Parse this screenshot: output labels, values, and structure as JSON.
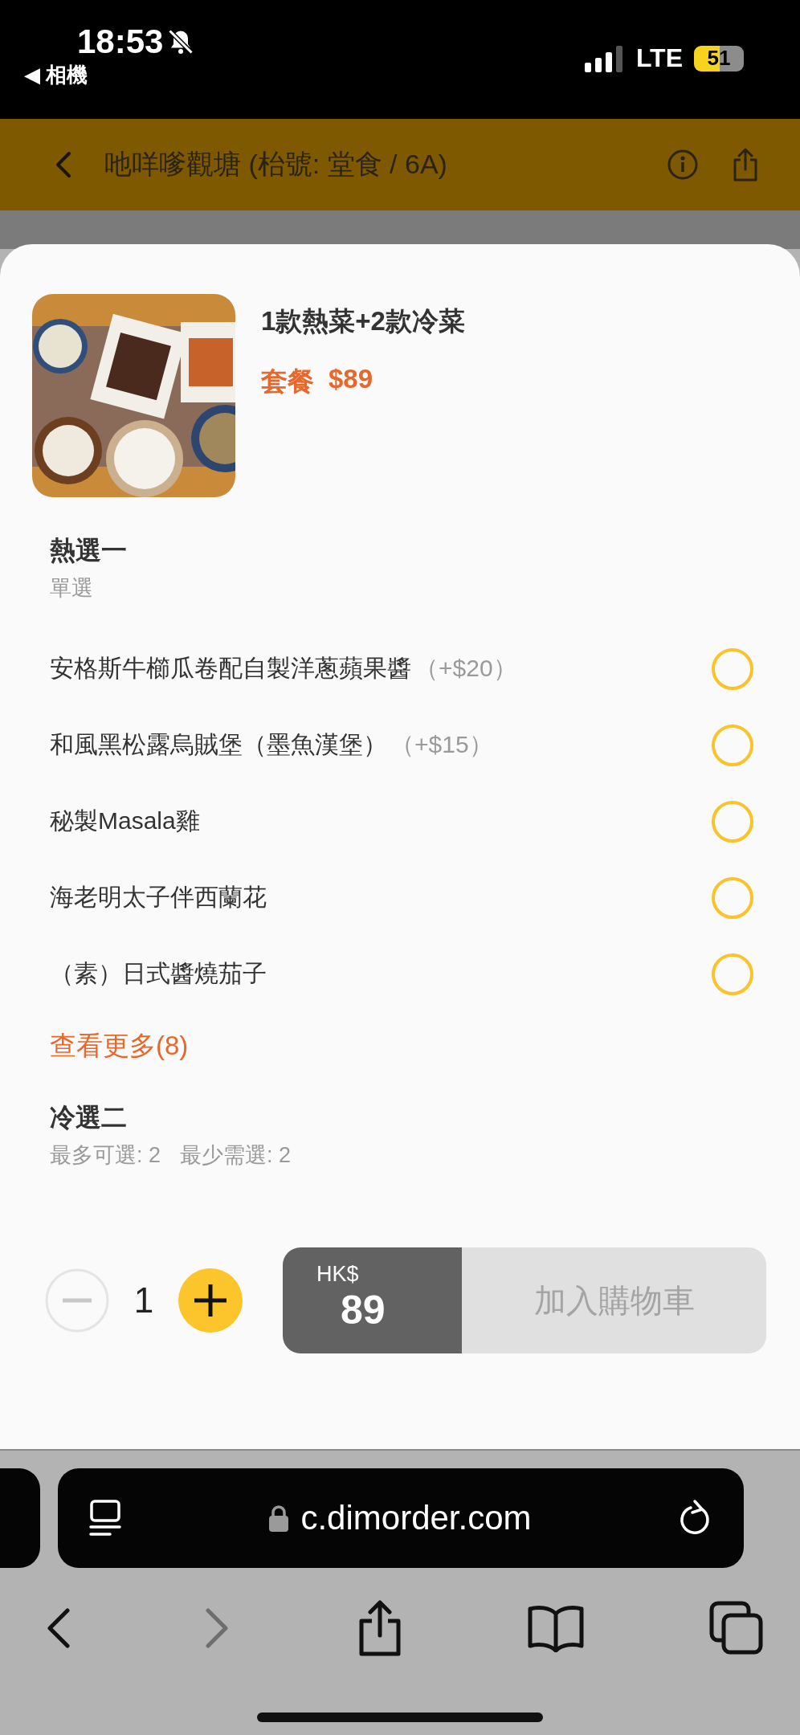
{
  "status_bar": {
    "time": "18:53",
    "back_app": "◀ 相機",
    "network": "LTE",
    "battery": "51"
  },
  "header": {
    "title": "吔咩嗲觀塘 (枱號: 堂食 / 6A)"
  },
  "item": {
    "name": "1款熱菜+2款冷菜",
    "price_label": "套餐",
    "price": "$89"
  },
  "groups": [
    {
      "title": "熱選一",
      "rules": [
        "單選"
      ],
      "options": [
        {
          "name": "安格斯牛櫛瓜卷配自製洋蔥蘋果醬",
          "extra": "（+$20）",
          "selected": false
        },
        {
          "name": "和風黑松露烏賊堡（墨魚漢堡）",
          "extra": "（+$15）",
          "selected": false
        },
        {
          "name": "秘製Masala雞",
          "selected": false
        },
        {
          "name": "海老明太子伴西蘭花",
          "selected": false
        },
        {
          "name": "（素）日式醬燒茄子",
          "selected": false
        }
      ],
      "more_link": "查看更多(8)"
    },
    {
      "title": "冷選二",
      "rules": [
        "最多可選: 2",
        "最少需選: 2"
      ]
    }
  ],
  "order_bar": {
    "decrease_disabled": true,
    "quantity": "1",
    "currency": "HK$",
    "total": "89",
    "add_button": "加入購物車",
    "add_disabled": true
  },
  "browser": {
    "url": "c.dimorder.com",
    "forward_disabled": true
  }
}
